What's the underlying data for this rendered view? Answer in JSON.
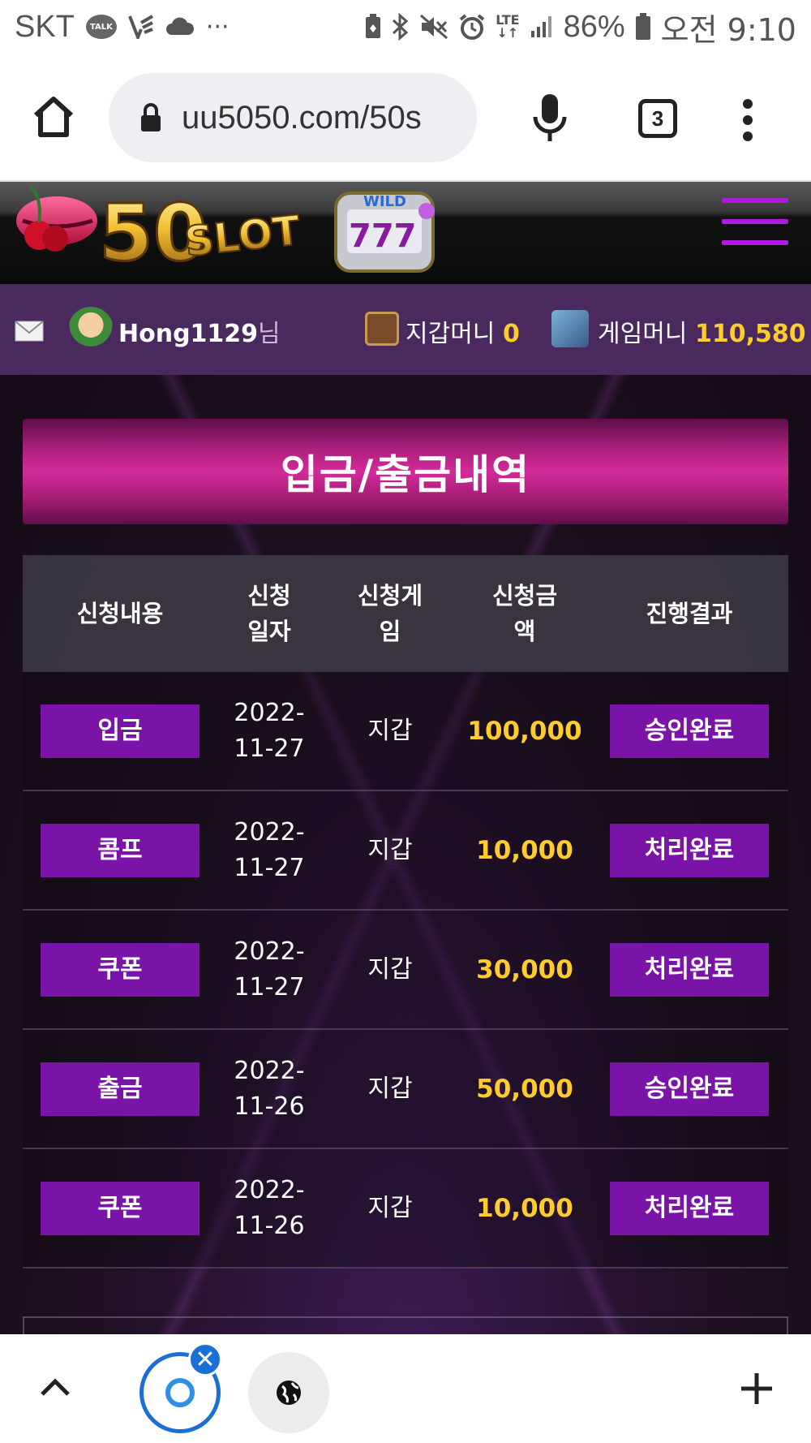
{
  "status_bar": {
    "carrier": "SKT",
    "talk_badge": "TALK",
    "more": "···",
    "network": "LTE",
    "battery": "86%",
    "time": "오전 9:10",
    "icons": [
      "kakaotalk-icon",
      "v-app-icon",
      "cloud-icon",
      "battery-saver-icon",
      "bluetooth-icon",
      "mute-icon",
      "alarm-icon",
      "lte-icon",
      "signal-icon",
      "battery-icon"
    ]
  },
  "browser": {
    "url": "uu5050.com/50s",
    "tab_count": "3",
    "icons": [
      "home-icon",
      "lock-icon",
      "mic-icon",
      "tabs-icon",
      "more-vert-icon"
    ]
  },
  "site": {
    "logo_text": "50SLOT",
    "menu_icon": "hamburger-icon"
  },
  "user_bar": {
    "username": "Hong1129",
    "username_suffix": "님",
    "wallet_label": "지갑머니",
    "wallet_value": "0",
    "game_label": "게임머니",
    "game_value": "110,580"
  },
  "page": {
    "title": "입금/출금내역"
  },
  "table": {
    "headers": [
      {
        "label": "신청내용"
      },
      {
        "label": "신청\n일자"
      },
      {
        "label": "신청게\n임"
      },
      {
        "label": "신청금\n액"
      },
      {
        "label": "진행결과"
      }
    ],
    "rows": [
      {
        "type": "입금",
        "date": "2022-\n11-27",
        "game": "지갑",
        "amount": "100,000",
        "result": "승인완료"
      },
      {
        "type": "콤프",
        "date": "2022-\n11-27",
        "game": "지갑",
        "amount": "10,000",
        "result": "처리완료"
      },
      {
        "type": "쿠폰",
        "date": "2022-\n11-27",
        "game": "지갑",
        "amount": "30,000",
        "result": "처리완료"
      },
      {
        "type": "출금",
        "date": "2022-\n11-26",
        "game": "지갑",
        "amount": "50,000",
        "result": "승인완료"
      },
      {
        "type": "쿠폰",
        "date": "2022-\n11-26",
        "game": "지갑",
        "amount": "10,000",
        "result": "처리완료"
      }
    ]
  },
  "colors": {
    "accent_purple": "#7a14a8",
    "amount_yellow": "#ffcc2a",
    "title_pink": "#d12b98",
    "user_bar_bg": "#4a2a5e"
  },
  "bottom_nav": {
    "icons": [
      "chevron-up-icon",
      "ie-tab-icon",
      "close-icon",
      "globe-icon",
      "plus-icon"
    ],
    "close_glyph": "✕",
    "plus_glyph": "+"
  }
}
